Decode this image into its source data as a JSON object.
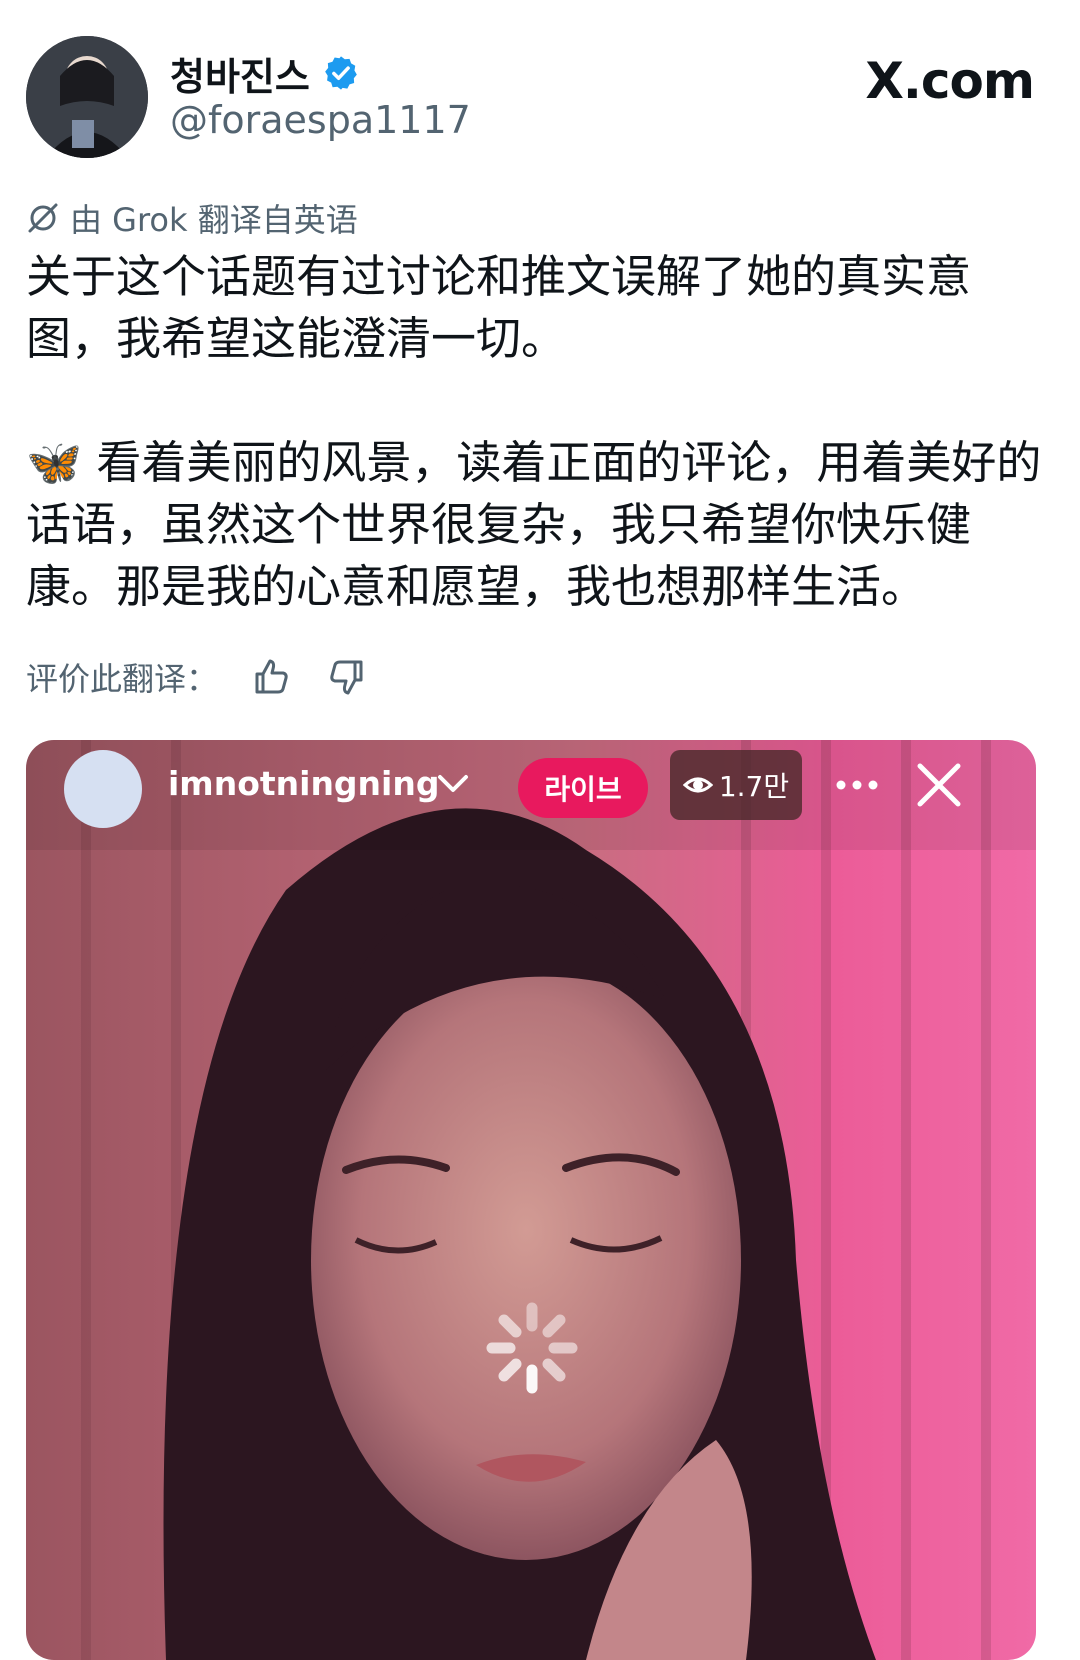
{
  "header": {
    "display_name": "청바진스",
    "handle": "@foraespa1117",
    "site": "X.com"
  },
  "translation": {
    "note": "由 Grok 翻译自英语",
    "rate_label": "评价此翻译："
  },
  "tweet": {
    "paragraph1": "关于这个话题有过讨论和推文误解了她的真实意图，我希望这能澄清一切。",
    "paragraph2": "🦋 看着美丽的风景，读着正面的评论，用着美好的话语，虽然这个世界很复杂，我只希望你快乐健康。那是我的心意和愿望，我也想那样生活。"
  },
  "live": {
    "username": "imnotningning",
    "badge": "라이브",
    "viewers": "1.7만"
  },
  "colors": {
    "verified": "#1d9bf0",
    "live_badge": "#e8195e",
    "text_secondary": "#536471"
  },
  "icons": [
    "verified-badge-icon",
    "grok-translate-icon",
    "thumbs-up-icon",
    "thumbs-down-icon",
    "chevron-down-icon",
    "eye-icon",
    "more-icon",
    "close-icon",
    "loading-spinner-icon"
  ]
}
